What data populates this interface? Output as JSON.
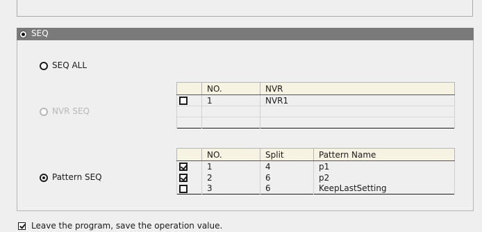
{
  "seq_section": {
    "label": "SEQ",
    "selected": true
  },
  "options": {
    "seq_all": {
      "label": "SEQ ALL",
      "selected": false,
      "enabled": true
    },
    "nvr_seq": {
      "label": "NVR SEQ",
      "selected": false,
      "enabled": false
    },
    "pattern_seq": {
      "label": "Pattern SEQ",
      "selected": true,
      "enabled": true
    }
  },
  "nvr_table": {
    "headers": {
      "no": "NO.",
      "nvr": "NVR"
    },
    "rows": [
      {
        "checked": false,
        "no": "1",
        "nvr": "NVR1"
      }
    ]
  },
  "pattern_table": {
    "headers": {
      "no": "NO.",
      "split": "Split",
      "pattern_name": "Pattern Name"
    },
    "rows": [
      {
        "checked": true,
        "no": "1",
        "split": "4",
        "pattern_name": "p1"
      },
      {
        "checked": true,
        "no": "2",
        "split": "6",
        "pattern_name": "p2"
      },
      {
        "checked": false,
        "no": "3",
        "split": "6",
        "pattern_name": "KeepLastSetting"
      }
    ]
  },
  "footer": {
    "save_on_exit_label": "Leave the program, save the operation value.",
    "save_on_exit_checked": true
  }
}
